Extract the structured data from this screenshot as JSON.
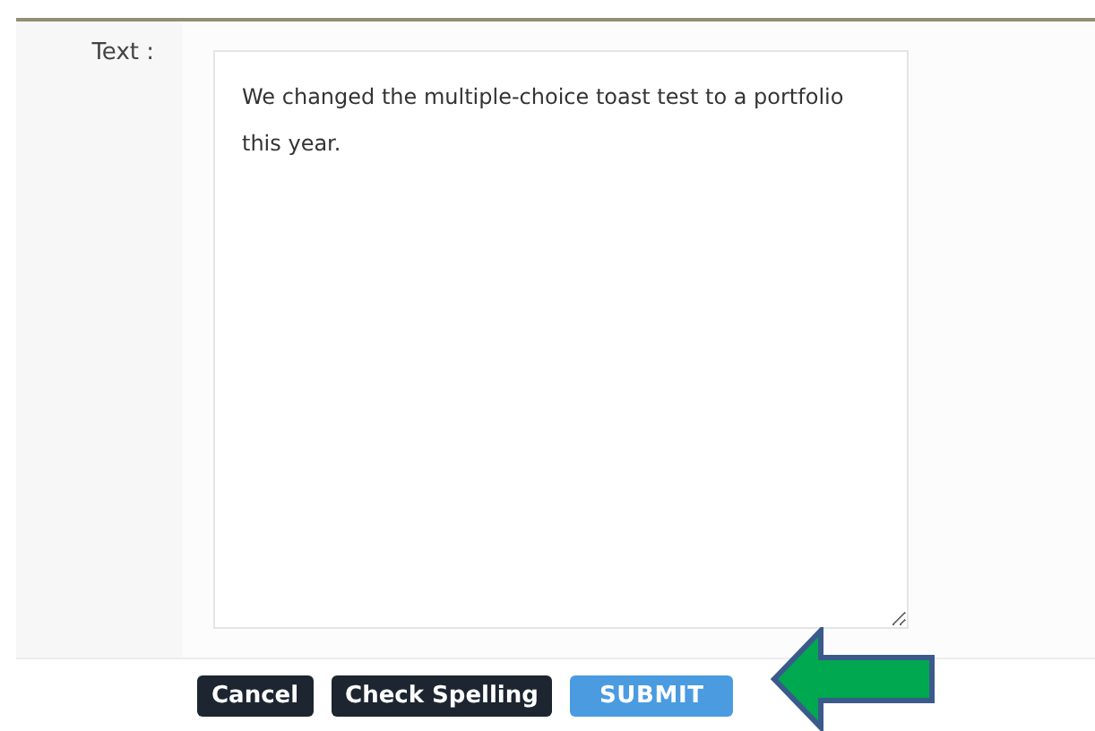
{
  "field": {
    "label": "Text :",
    "value": "We changed the multiple-choice toast test to a portfolio this year."
  },
  "buttons": [
    {
      "label": "Cancel",
      "kind": "secondary"
    },
    {
      "label": "Check Spelling",
      "kind": "secondary"
    },
    {
      "label": "SUBMIT",
      "kind": "primary"
    }
  ]
}
